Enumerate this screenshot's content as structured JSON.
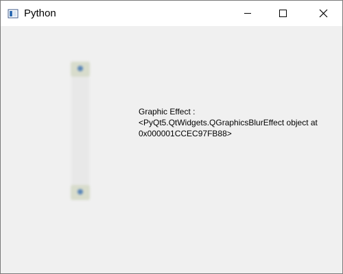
{
  "window": {
    "title": "Python",
    "controls": {
      "minimize_icon": "minimize-icon",
      "maximize_icon": "maximize-icon",
      "close_icon": "close-icon"
    }
  },
  "content": {
    "label_lines": [
      "Graphic Effect :",
      "<PyQt5.QtWidgets.QGraphicsBlurEffect object at",
      "0x000001CCEC97FB88>"
    ]
  },
  "colors": {
    "titlebar": "#ffffff",
    "client_bg": "#f0f0f0",
    "scroll_button": "#d8dccc"
  }
}
